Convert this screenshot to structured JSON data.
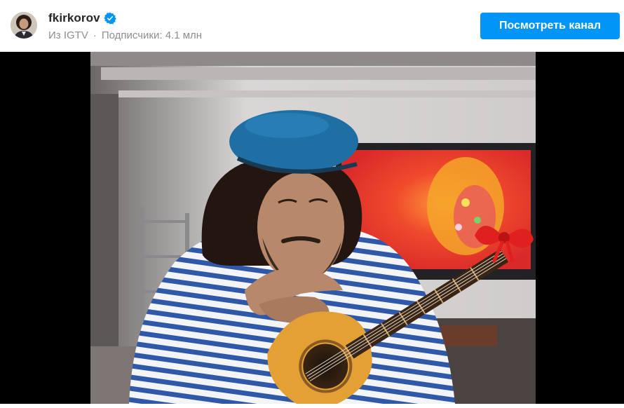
{
  "header": {
    "username": "fkirkorov",
    "verified_icon": "verified-badge-icon",
    "source": "Из IGTV",
    "separator": "·",
    "subscribers": "Подписчики: 4.1 млн",
    "view_channel_button": "Посмотреть канал"
  },
  "colors": {
    "accent": "#0095f6",
    "username": "#262626",
    "muted": "#8e8e8e",
    "video_background": "#000000"
  },
  "video": {
    "icon": "video-thumbnail"
  }
}
